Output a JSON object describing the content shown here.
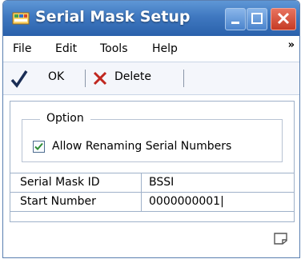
{
  "window": {
    "title": "Serial Mask Setup"
  },
  "menu": {
    "items": [
      "File",
      "Edit",
      "Tools",
      "Help"
    ],
    "overflow_symbol": "»"
  },
  "toolbar": {
    "ok_label": "OK",
    "delete_label": "Delete"
  },
  "option_group": {
    "title": "Option",
    "checkbox_label": "Allow Renaming Serial Numbers",
    "checkbox_checked": true
  },
  "fields": [
    {
      "label": "Serial Mask ID",
      "value": "BSSI"
    },
    {
      "label": "Start Number",
      "value": "0000000001|"
    }
  ],
  "colors": {
    "titlebar": "#3f78c0",
    "ok_check": "#1a2d55",
    "delete_x": "#c0271f",
    "checkbox_check": "#2f8d33"
  }
}
